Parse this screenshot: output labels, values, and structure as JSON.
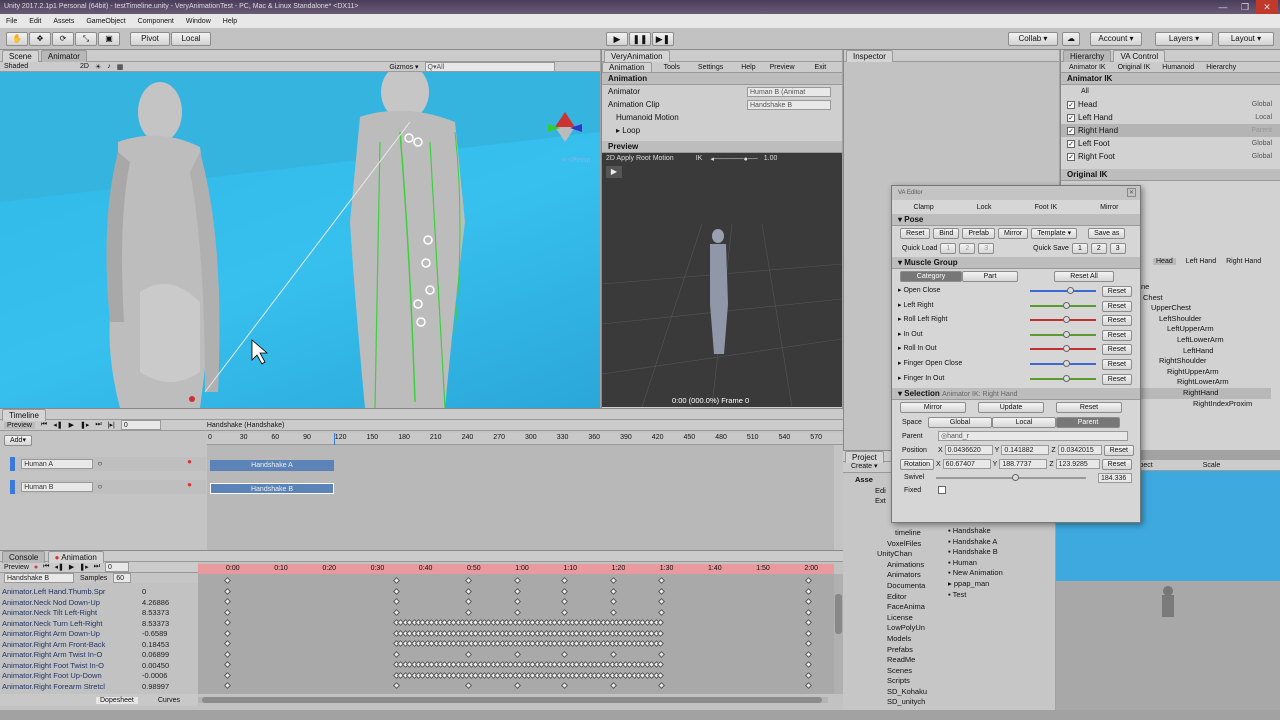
{
  "window": {
    "title": "Unity 2017.2.1p1 Personal (64bit) - testTimeline.unity - VeryAnimationTest - PC, Mac & Linux Standalone* <DX11>",
    "controls": [
      "—",
      "❐",
      "✕"
    ]
  },
  "menu": [
    "File",
    "Edit",
    "Assets",
    "GameObject",
    "Component",
    "Window",
    "Help"
  ],
  "toolbar": {
    "pivot": "Pivot",
    "local": "Local",
    "collab": "Collab ▾",
    "account": "Account ▾",
    "layers": "Layers ▾",
    "layout": "Layout ▾"
  },
  "scene": {
    "tab_scene": "Scene",
    "tab_animator": "Animator",
    "shading": "Shaded",
    "mode2d": "2D",
    "gizmos": "Gizmos ▾",
    "search_placeholder": "Q▾All",
    "persp": "Persp"
  },
  "very": {
    "tab": "VeryAnimation",
    "tabs": [
      "Animation",
      "Tools",
      "Settings",
      "Help",
      "Preview",
      "Exit"
    ],
    "section": "Animation",
    "animator_label": "Animator",
    "animator_value": "Human B (Animat",
    "clip_label": "Animation Clip",
    "clip_value": "Handshake B",
    "humanoid": "Humanoid Motion",
    "loop": "Loop",
    "preview_label": "Preview",
    "preview_toolbar": "2D  Apply Root Motion",
    "ik": "IK",
    "speed": "1.00",
    "frame": "0:00 (000.0%) Frame 0"
  },
  "inspector": {
    "tab": "Inspector"
  },
  "hierarchy": {
    "tab": "Hierarchy",
    "tab2": "VA Control",
    "subtabs": [
      "Animator IK",
      "Original IK",
      "Humanoid",
      "Hierarchy"
    ],
    "section": "Animator IK",
    "all": "All",
    "items": [
      {
        "name": "Head",
        "space": "Global"
      },
      {
        "name": "Left Hand",
        "space": "Local"
      },
      {
        "name": "Right Hand",
        "space": "Parent"
      },
      {
        "name": "Left Foot",
        "space": "Global"
      },
      {
        "name": "Right Foot",
        "space": "Global"
      }
    ],
    "section2": "Original IK",
    "tabs2": [
      "Head",
      "Left Hand",
      "Right Hand"
    ],
    "tree": [
      "ne",
      "Chest",
      "UpperChest",
      "LeftShoulder",
      "LeftUpperArm",
      "LeftLowerArm",
      "LeftHand",
      "RightShoulder",
      "RightUpperArm",
      "RightLowerArm",
      "RightHand",
      "RightIndexProxim"
    ]
  },
  "va_editor": {
    "title": "VA Editor",
    "tabs": [
      "Clamp",
      "Lock",
      "Foot IK",
      "Mirror"
    ],
    "pose": "Pose",
    "pose_buttons": [
      "Reset",
      "Bind",
      "Prefab",
      "Mirror",
      "Template ▾"
    ],
    "save_as": "Save as",
    "quick_load": "Quick Load",
    "quick_save": "Quick Save",
    "slots": [
      "1",
      "2",
      "3"
    ],
    "muscle_group": "Muscle Group",
    "category": "Category",
    "part": "Part",
    "reset_all": "Reset All",
    "muscles": [
      {
        "name": "Open Close",
        "color": "#3a6ad0",
        "pos": 0.6
      },
      {
        "name": "Left Right",
        "color": "#5a9a30",
        "pos": 0.55
      },
      {
        "name": "Roll Left Right",
        "color": "#c03030",
        "pos": 0.55
      },
      {
        "name": "In Out",
        "color": "#5a9a30",
        "pos": 0.55
      },
      {
        "name": "Roll In Out",
        "color": "#c03030",
        "pos": 0.55
      },
      {
        "name": "Finger Open Close",
        "color": "#3a6ad0",
        "pos": 0.55
      },
      {
        "name": "Finger In Out",
        "color": "#5a9a30",
        "pos": 0.55
      }
    ],
    "reset": "Reset",
    "selection": "Selection",
    "selection_sub": "Animator IK: Right Hand",
    "mirror": "Mirror",
    "update": "Update",
    "space": "Space",
    "space_opts": [
      "Global",
      "Local",
      "Parent"
    ],
    "parent_label": "Parent",
    "parent_value": "◎hand_r",
    "position": "Position",
    "pos_x": "0.0436620",
    "pos_y": "0.141882",
    "pos_z": "0.0342015",
    "rotation": "Rotation",
    "rot_x": "60.67407",
    "rot_y": "188.7737",
    "rot_z": "123.9285",
    "swivel": "Swivel",
    "swivel_value": "184.336",
    "fixed": "Fixed"
  },
  "project": {
    "tab": "Project",
    "create": "Create ▾",
    "tree": [
      "Asse",
      "Edi",
      "Ext",
      "",
      "",
      "timeline",
      "VoxelFiles",
      "UnityChan",
      "Animations",
      "Animators",
      "Documenta",
      "Editor",
      "FaceAnima",
      "License",
      "LowPolyUn",
      "Models",
      "Prefabs",
      "ReadMe",
      "Scenes",
      "Scripts",
      "SD_Kohaku",
      "SD_unitych"
    ],
    "files": [
      "Handshake",
      "Handshake A",
      "Handshake B",
      "Human",
      "New Animation",
      "ppap_man",
      "Test"
    ]
  },
  "game": {
    "aspect": "spect",
    "scale": "Scale"
  },
  "timeline": {
    "tab": "Timeline",
    "preview": "Preview",
    "frame": "0",
    "add": "Add▾",
    "clip_title": "Handshake (Handshake)",
    "ticks": [
      "0",
      "30",
      "60",
      "90",
      "120",
      "150",
      "180",
      "210",
      "240",
      "270",
      "300",
      "330",
      "360",
      "390",
      "420",
      "450",
      "480",
      "510",
      "540",
      "570"
    ],
    "tracks": [
      {
        "name": "Human A",
        "clip": "Handshake A"
      },
      {
        "name": "Human B",
        "clip": "Handshake B"
      }
    ]
  },
  "animation": {
    "tab_console": "Console",
    "tab_anim": "Animation",
    "preview": "Preview",
    "clip": "Handshake B",
    "samples_label": "Samples",
    "samples": "60",
    "ticks": [
      "0:00",
      "0:10",
      "0:20",
      "0:30",
      "0:40",
      "0:50",
      "1:00",
      "1:10",
      "1:20",
      "1:30",
      "1:40",
      "1:50",
      "2:00"
    ],
    "properties": [
      {
        "name": "Animator.Left Hand.Thumb.Spr",
        "value": "0"
      },
      {
        "name": "Animator.Neck Nod Down-Up",
        "value": "4.26886"
      },
      {
        "name": "Animator.Neck Tilt Left-Right",
        "value": "8.53373"
      },
      {
        "name": "Animator.Neck Turn Left-Right",
        "value": "8.53373"
      },
      {
        "name": "Animator.Right Arm Down-Up",
        "value": "-0.6589"
      },
      {
        "name": "Animator.Right Arm Front-Back",
        "value": "0.18453"
      },
      {
        "name": "Animator.Right Arm Twist In-O",
        "value": "0.06899"
      },
      {
        "name": "Animator.Right Foot Twist In-O",
        "value": "0.00450"
      },
      {
        "name": "Animator.Right Foot Up-Down",
        "value": "-0.0006"
      },
      {
        "name": "Animator.Right Forearm Stretcl",
        "value": "0.98997"
      }
    ],
    "dopesheet": "Dopesheet",
    "curves": "Curves"
  }
}
